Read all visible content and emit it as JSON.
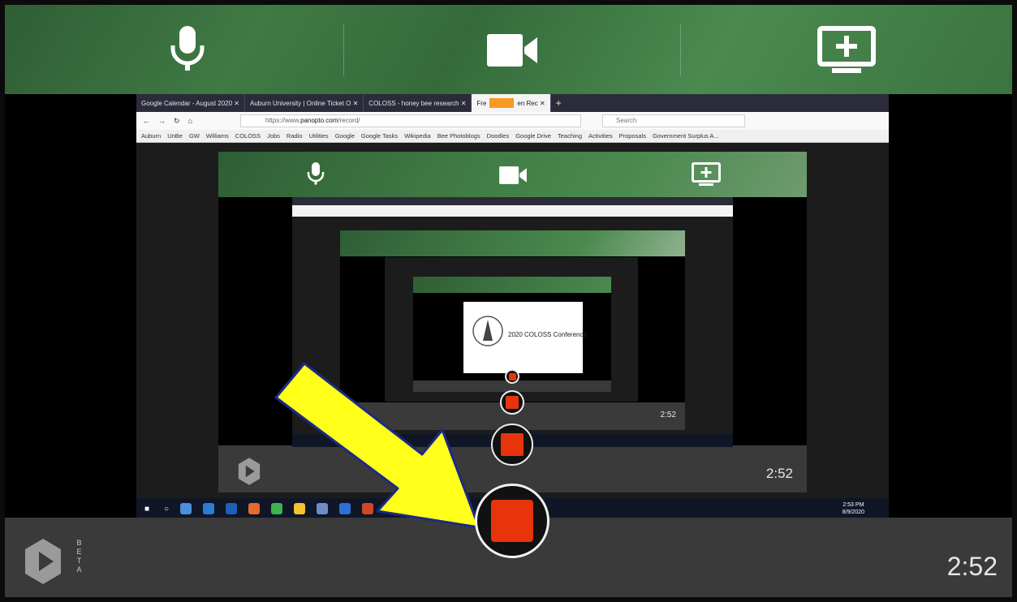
{
  "toolbar": {
    "mic_icon": "microphone-icon",
    "camera_icon": "video-camera-icon",
    "screen_icon": "add-screen-icon"
  },
  "recording": {
    "elapsed": "2:52",
    "beta_label": "BETA",
    "stop_color": "#e8340b"
  },
  "browser": {
    "tabs": [
      {
        "label": "Google Calendar - August 2020 ✕"
      },
      {
        "label": "Auburn University | Online Ticket O ✕"
      },
      {
        "label": "COLOSS - honey bee research ✕"
      },
      {
        "label": "Fre"
      },
      {
        "label": "en Rec ✕",
        "active": true
      }
    ],
    "url_prefix": "https://www.",
    "url_domain": "panopto.com",
    "url_suffix": "/record/",
    "search_placeholder": "Search",
    "bookmarks": [
      "Auburn",
      "UnBe",
      "GW",
      "Williams",
      "COLOSS",
      "Jobs",
      "Radio",
      "Utilities",
      "Google",
      "Google Tasks",
      "Wikipedia",
      "Bee Photoblogs",
      "Doodles",
      "Google Drive",
      "Teaching",
      "Activities",
      "Proposals",
      "Government Surplus A..."
    ],
    "inner_elapsed": "2:52",
    "clock_time": "2:53 PM",
    "clock_date": "8/9/2020"
  },
  "nested": {
    "elapsed": "2:52",
    "slide_title": "2020 COLOSS Conference"
  }
}
